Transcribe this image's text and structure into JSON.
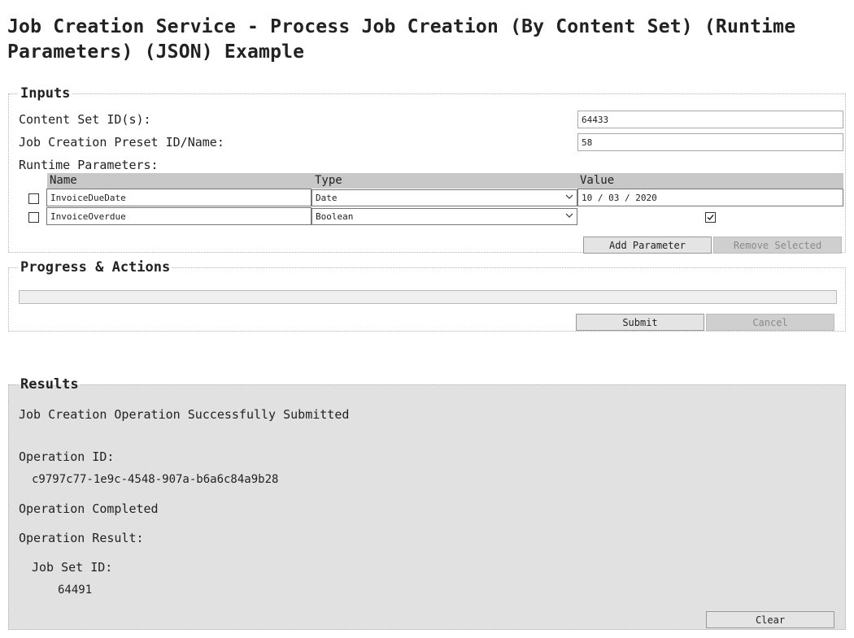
{
  "page": {
    "title": "Job Creation Service - Process Job Creation (By Content Set) (Runtime Parameters) (JSON) Example"
  },
  "inputs": {
    "legend": "Inputs",
    "content_set_label": "Content Set ID(s):",
    "content_set_value": "64433",
    "preset_label": "Job Creation Preset ID/Name:",
    "preset_value": "58",
    "runtime_label": "Runtime Parameters:",
    "table": {
      "headers": {
        "name": "Name",
        "type": "Type",
        "value": "Value"
      },
      "rows": [
        {
          "name": "InvoiceDueDate",
          "type": "Date",
          "value": "10 / 03 / 2020",
          "selected": false
        },
        {
          "name": "InvoiceOverdue",
          "type": "Boolean",
          "value": "true",
          "selected": false
        }
      ]
    },
    "add_label": "Add Parameter",
    "remove_label": "Remove Selected"
  },
  "progress": {
    "legend": "Progress & Actions",
    "value": 0,
    "submit_label": "Submit",
    "cancel_label": "Cancel"
  },
  "results": {
    "legend": "Results",
    "status": "Job Creation Operation Successfully Submitted",
    "op_id_label": "Operation ID:",
    "op_id_value": "c9797c77-1e9c-4548-907a-b6a6c84a9b28",
    "completed": "Operation Completed",
    "result_label": "Operation Result:",
    "job_set_label": "Job Set ID:",
    "job_set_value": "64491",
    "clear_label": "Clear"
  },
  "icons": {
    "dropdown": "chevron-down-icon",
    "checkbox": "checkbox-icon",
    "check": "checkmark-icon"
  }
}
